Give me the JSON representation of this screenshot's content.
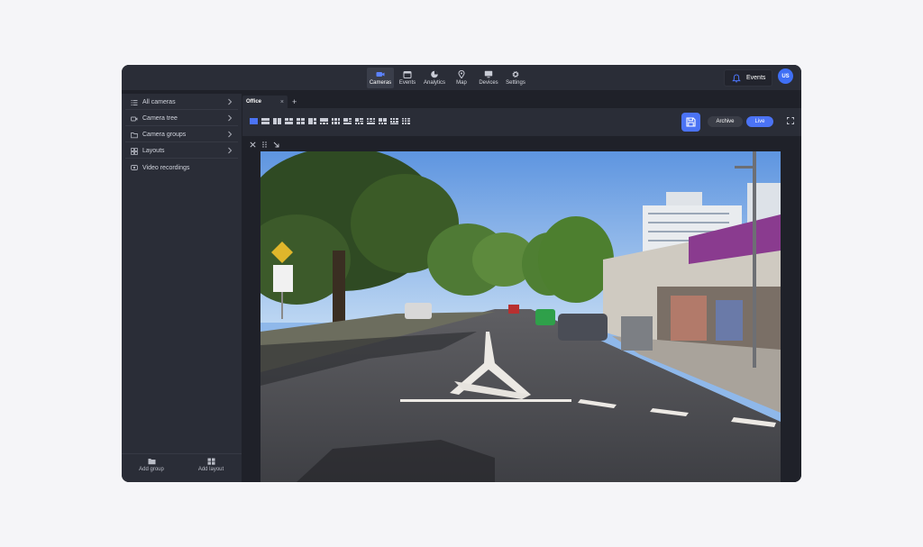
{
  "topbar": {
    "nav": [
      {
        "label": "Cameras",
        "icon": "camera-icon",
        "active": true
      },
      {
        "label": "Events",
        "icon": "calendar-icon",
        "active": false
      },
      {
        "label": "Analytics",
        "icon": "pie-chart-icon",
        "active": false
      },
      {
        "label": "Map",
        "icon": "map-pin-icon",
        "active": false
      },
      {
        "label": "Devices",
        "icon": "monitor-icon",
        "active": false
      },
      {
        "label": "Settings",
        "icon": "gear-icon",
        "active": false
      }
    ],
    "events_label": "Events",
    "avatar_initials": "US"
  },
  "sidebar": {
    "items": [
      {
        "label": "All cameras",
        "icon": "list-icon",
        "has_chevron": true
      },
      {
        "label": "Camera tree",
        "icon": "camera-tree-icon",
        "has_chevron": true
      },
      {
        "label": "Camera groups",
        "icon": "folder-icon",
        "has_chevron": true
      },
      {
        "label": "Layouts",
        "icon": "grid-icon",
        "has_chevron": true
      },
      {
        "label": "Video recordings",
        "icon": "video-recording-icon",
        "has_chevron": false
      }
    ],
    "footer": {
      "add_group": "Add group",
      "add_layout": "Add layout"
    }
  },
  "tabs": [
    {
      "label": "Office",
      "active": true
    }
  ],
  "toolbar": {
    "archive_label": "Archive",
    "live_label": "Live",
    "layout_options": 14,
    "active_layout": 1
  },
  "colors": {
    "accent": "#4b73f5",
    "panel": "#2a2d37",
    "background": "#1f2129"
  }
}
